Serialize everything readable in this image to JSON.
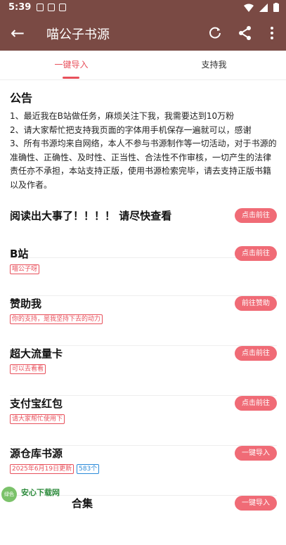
{
  "status_bar": {
    "time": "5:39"
  },
  "appbar": {
    "title": "喵公子书源"
  },
  "tabs": [
    {
      "label": "一键导入"
    },
    {
      "label": "支持我"
    }
  ],
  "notice": {
    "title": "公告",
    "lines": [
      "1、最近我在B站做任务，麻烦关注下我，我需要达到10万粉",
      "2、请大家帮忙把支持我页面的字体用手机保存一遍就可以，感谢",
      "3、所有书源均来自网络，本人不参与书源制作等一切活动，对于书源的准确性、正确性、及时性、正当性、合法性不作审核，一切产生的法律责任亦不承担，本站支持正版，使用书源检索完毕，请去支持正版书籍以及作者。"
    ]
  },
  "items": [
    {
      "name": "阅读出大事了！！！！ 请尽快查看",
      "tags": [],
      "button": "点击前往"
    },
    {
      "name": "B站",
      "tags": [
        "喵公子呀"
      ],
      "button": "点击前往"
    },
    {
      "name": "赞助我",
      "tags": [
        "你的支持，是我坚持下去的动力"
      ],
      "button": "前往赞助"
    },
    {
      "name": "超大流量卡",
      "tags": [
        "可以去看看"
      ],
      "button": "点击前往"
    },
    {
      "name": "支付宝红包",
      "tags": [
        "请大家帮忙使用下"
      ],
      "button": "点击前往"
    },
    {
      "name": "源仓库书源",
      "tags": [
        "2025年6月19日更新"
      ],
      "blue_tag": "583个",
      "button": "一键导入"
    },
    {
      "name": "合集",
      "tags": [],
      "button": "一键导入"
    }
  ],
  "watermark": {
    "logo_text": "绿色",
    "text": "安心下载网"
  }
}
